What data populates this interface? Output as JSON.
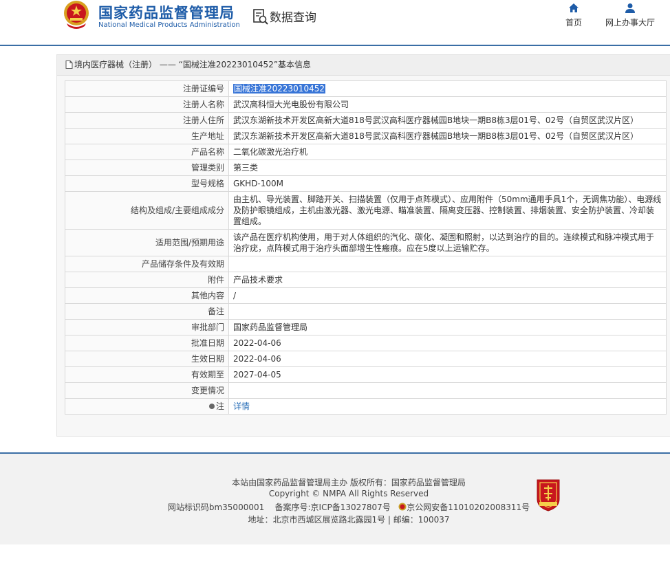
{
  "header": {
    "site_name": "国家药品监督管理局",
    "site_name_en": "National Medical Products Administration",
    "query_title": "数据查询",
    "nav": [
      {
        "label": "首页",
        "icon": "home-icon"
      },
      {
        "label": "网上办事大厅",
        "icon": "user-icon"
      }
    ]
  },
  "panel": {
    "title": "境内医疗器械（注册） —— “国械注准20223010452”基本信息"
  },
  "rows": [
    {
      "label": "注册证编号",
      "value": "国械注准20223010452"
    },
    {
      "label": "注册人名称",
      "value": "武汉高科恒大光电股份有限公司"
    },
    {
      "label": "注册人住所",
      "value": "武汉东湖新技术开发区高新大道818号武汉高科医疗器械园B地块一期B8栋3层01号、02号（自贸区武汉片区）"
    },
    {
      "label": "生产地址",
      "value": "武汉东湖新技术开发区高新大道818号武汉高科医疗器械园B地块一期B8栋3层01号、02号（自贸区武汉片区）"
    },
    {
      "label": "产品名称",
      "value": "二氧化碳激光治疗机"
    },
    {
      "label": "管理类别",
      "value": "第三类"
    },
    {
      "label": "型号规格",
      "value": "GKHD-100M"
    },
    {
      "label": "结构及组成/主要组成成分",
      "value": "由主机、导光装置、脚踏开关、扫描装置（仅用于点阵模式）、应用附件（50mm通用手具1个，无调焦功能）、电源线及防护眼镜组成，主机由激光器、激光电源、瞄准装置、隔离变压器、控制装置、排烟装置、安全防护装置、冷却装置组成。"
    },
    {
      "label": "适用范围/预期用途",
      "value": "该产品在医疗机构使用，用于对人体组织的汽化、碳化、凝固和照射，以达到治疗的目的。连续模式和脉冲模式用于治疗疣，点阵模式用于治疗头面部增生性瘢痕。应在5度以上运输贮存。"
    },
    {
      "label": "产品储存条件及有效期",
      "value": ""
    },
    {
      "label": "附件",
      "value": "产品技术要求"
    },
    {
      "label": "其他内容",
      "value": "/"
    },
    {
      "label": "备注",
      "value": ""
    },
    {
      "label": "审批部门",
      "value": "国家药品监督管理局"
    },
    {
      "label": "批准日期",
      "value": "2022-04-06"
    },
    {
      "label": "生效日期",
      "value": "2022-04-06"
    },
    {
      "label": "有效期至",
      "value": "2027-04-05"
    },
    {
      "label": "变更情况",
      "value": ""
    },
    {
      "label": "注",
      "value": "详情"
    }
  ],
  "footer": {
    "line1": "本站由国家药品监督管理局主办 版权所有：国家药品监督管理局",
    "line2": "Copyright © NMPA All Rights Reserved",
    "line3_site_id": "网站标识码bm35000001",
    "line3_icp": "备案序号:京ICP备13027807号",
    "line3_police": "京公网安备11010202008311号",
    "line4": "地址：北京市西城区展览路北露园1号 | 邮编：100037"
  },
  "colors": {
    "brand_blue": "#1e5ca8",
    "selection": "#3875d7",
    "link": "#2a6fb8"
  }
}
